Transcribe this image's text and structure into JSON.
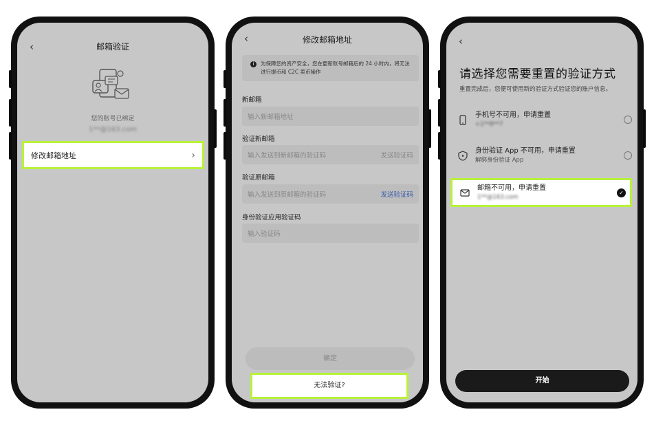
{
  "phone1": {
    "back_icon": "chevron-left",
    "title": "邮箱验证",
    "bound_text": "您的账号已绑定",
    "bound_email": "1**@163.com",
    "row_label": "修改邮箱地址",
    "row_chevron": "›"
  },
  "phone2": {
    "back_icon": "chevron-left",
    "title": "修改邮箱地址",
    "notice": "为保障您的资产安全，您在更新账号邮箱后的 24 小时内，将无法进行提币和 C2C 卖币操作",
    "fields": [
      {
        "label": "新邮箱",
        "placeholder": "输入新邮箱地址",
        "action": ""
      },
      {
        "label": "验证新邮箱",
        "placeholder": "输入发送到新邮箱的验证码",
        "action": "发送验证码"
      },
      {
        "label": "验证原邮箱",
        "placeholder": "输入发送到原邮箱的验证码",
        "action": "发送验证码"
      },
      {
        "label": "身份验证应用验证码",
        "placeholder": "输入验证码",
        "action": ""
      }
    ],
    "confirm_label": "确定",
    "cant_verify_label": "无法验证?"
  },
  "phone3": {
    "back_icon": "chevron-left",
    "title": "请选择您需要重置的验证方式",
    "subtitle": "重置完成后，您便可使用新的验证方式验证您的账户信息。",
    "options": [
      {
        "icon": "phone-icon",
        "label": "手机号不可用，申请重置",
        "detail": "+1**8**7"
      },
      {
        "icon": "shield-icon",
        "label": "身份验证 App 不可用，申请重置",
        "detail": "解绑身份验证 App"
      },
      {
        "icon": "mail-icon",
        "label": "邮箱不可用，申请重置",
        "detail": "1**@163.com"
      }
    ],
    "selected_option": 2,
    "start_label": "开始"
  },
  "colors": {
    "highlight": "#b7f23a",
    "link": "#3b5fae",
    "screen_bg": "#c7c7c7"
  }
}
